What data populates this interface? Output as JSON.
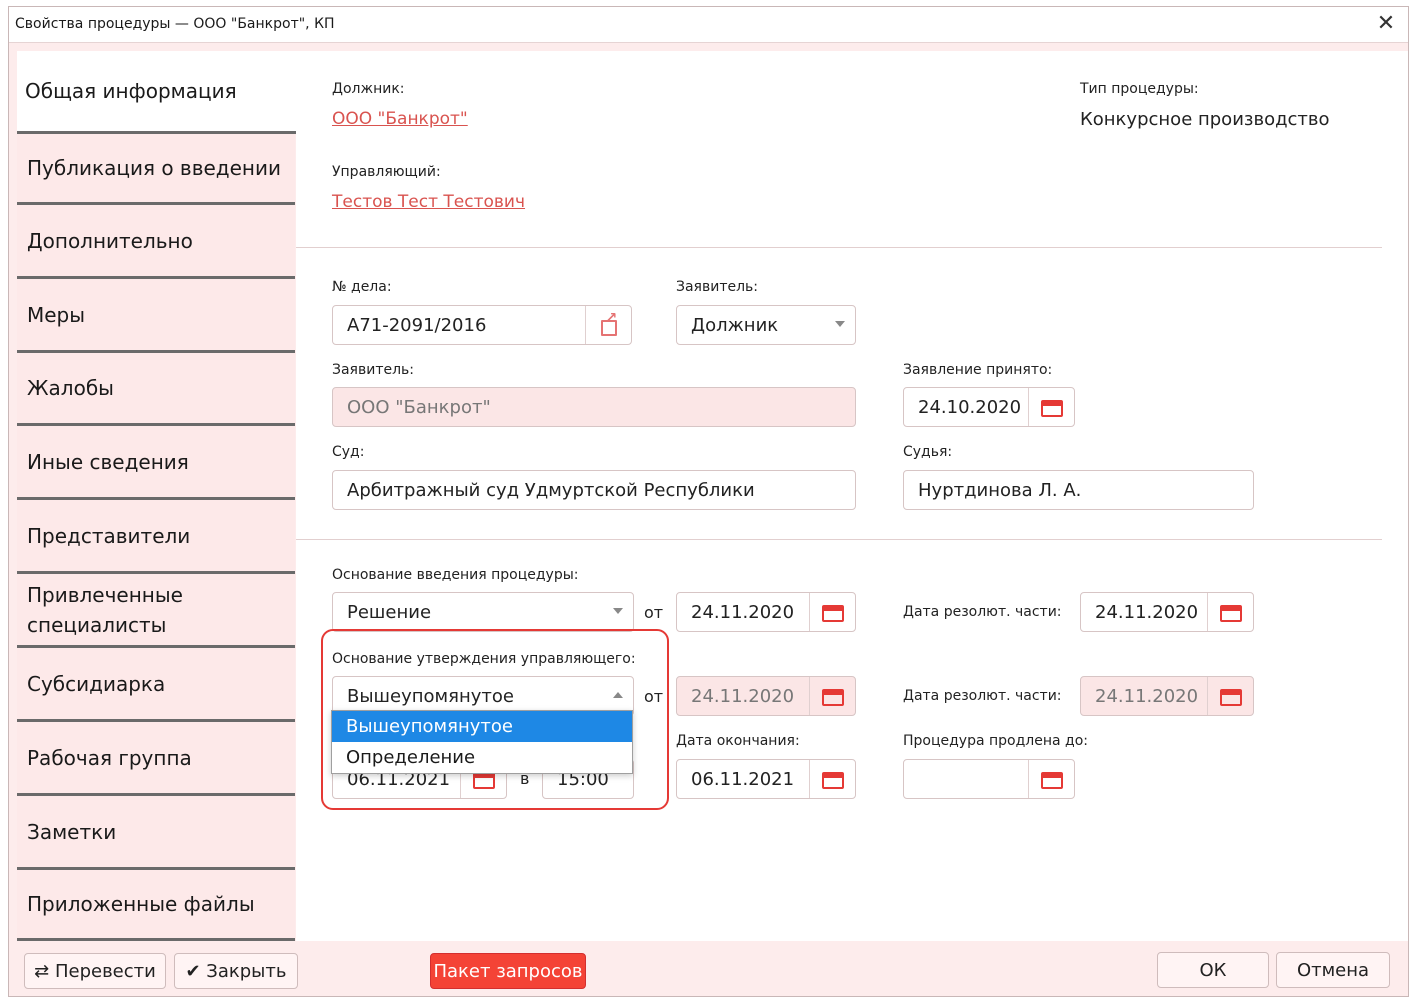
{
  "window": {
    "title": "Свойства процедуры — ООО \"Банкрот\", КП"
  },
  "tabs": [
    "Общая информация",
    "Публикация о введении",
    "Дополнительно",
    "Меры",
    "Жалобы",
    "Иные сведения",
    "Представители",
    "Привлеченные специалисты",
    "Субсидиарка",
    "Рабочая группа",
    "Заметки",
    "Приложенные файлы"
  ],
  "tabs_multiline": {
    "line1": "Привлеченные",
    "line2": "специалисты"
  },
  "header": {
    "debtor_label": "Должник:",
    "debtor_value": "ООО \"Банкрот\"",
    "manager_label": "Управляющий:",
    "manager_value": "Тестов Тест Тестович",
    "procedure_type_label": "Тип процедуры:",
    "procedure_type_value": "Конкурсное производство"
  },
  "case": {
    "case_no_label": "№ дела:",
    "case_no_value": "А71-2091/2016",
    "applicant_type_label": "Заявитель:",
    "applicant_type_value": "Должник",
    "applicant_label": "Заявитель:",
    "applicant_value": "ООО \"Банкрот\"",
    "accepted_label": "Заявление принято:",
    "accepted_value": "24.10.2020",
    "court_label": "Суд:",
    "court_value": "Арбитражный суд Удмуртской Республики",
    "judge_label": "Судья:",
    "judge_value": "Нуртдинова Л. А."
  },
  "basis": {
    "intro_label": "Основание введения процедуры:",
    "intro_value": "Решение",
    "from_label": "от",
    "intro_date": "24.11.2020",
    "resol_label": "Дата резолют. части:",
    "intro_resol_date": "24.11.2020",
    "approval_label": "Основание утверждения управляющего:",
    "approval_value": "Вышеупомянутое",
    "approval_date": "24.11.2020",
    "approval_resol_date": "24.11.2020",
    "dropdown_options": [
      "Вышеупомянутое",
      "Определение"
    ],
    "hidden_date": "06.11.2021",
    "hidden_sep": "в",
    "hidden_time": "15:00",
    "end_label": "Дата окончания:",
    "end_date": "06.11.2021",
    "extended_label": "Процедура продлена до:",
    "extended_value": ""
  },
  "footer": {
    "transfer": "⇄ Перевести",
    "close": "✔ Закрыть",
    "batch": "Пакет запросов",
    "ok": "ОК",
    "cancel": "Отмена"
  }
}
